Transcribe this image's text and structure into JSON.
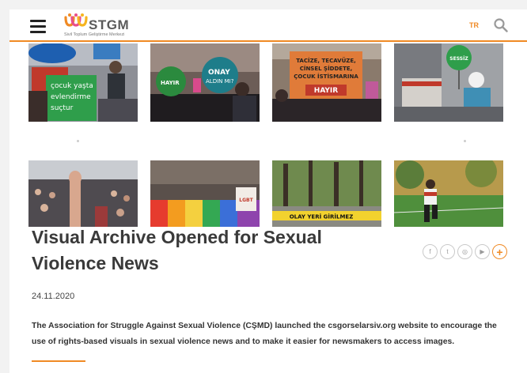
{
  "header": {
    "logo_text": "STGM",
    "logo_subtitle": "Sivil Toplum Geliştirme Merkezi",
    "language": "TR",
    "menu_icon": "hamburger-menu-icon",
    "search_icon": "search-icon"
  },
  "gallery": {
    "photo_signs": [
      [
        "çocuk yaşta",
        "evlendirme",
        "suçtur"
      ],
      [
        "HAYIR",
        "ONAY",
        "ALDIN MI?"
      ],
      [
        "TACİZE, TECAVÜZE,",
        "CİNSEL ŞİDDETE,",
        "ÇOCUK İSTİSMARINA",
        "HAYIR"
      ],
      [
        "SESSİZ"
      ],
      [],
      [
        "LGBT"
      ],
      [
        "OLAY YERİ GİRİLMEZ"
      ],
      []
    ]
  },
  "article": {
    "title": "Visual Archive Opened for Sexual Violence News",
    "date": "24.11.2020",
    "lead": "The Association for Struggle Against Sexual Violence (CŞMD) launched the csgorselarsiv.org website to encourage the use of rights-based visuals in sexual violence news and to make it easier for newsmakers to access images."
  },
  "social": [
    {
      "icon": "facebook-icon",
      "glyph": "f"
    },
    {
      "icon": "twitter-icon",
      "glyph": "t"
    },
    {
      "icon": "instagram-icon",
      "glyph": "◎"
    },
    {
      "icon": "youtube-icon",
      "glyph": "▶"
    },
    {
      "icon": "plus-icon",
      "glyph": "+"
    }
  ],
  "colors": {
    "accent": "#f08a24",
    "title": "#3a3a3a",
    "logo_gray": "#5a5a5a"
  }
}
